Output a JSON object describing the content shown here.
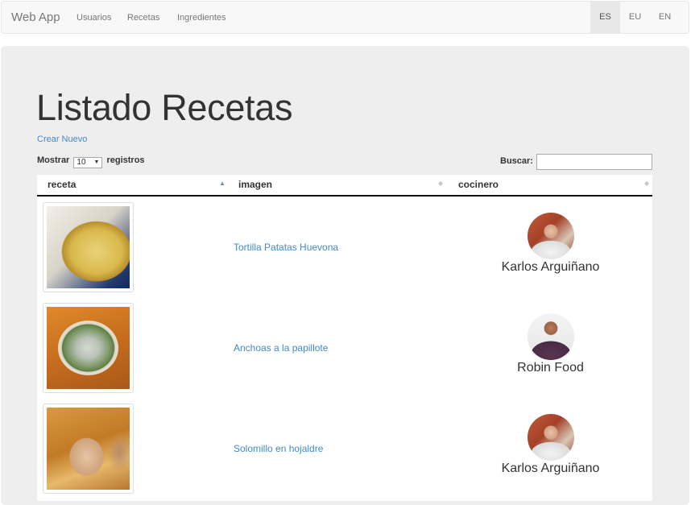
{
  "navbar": {
    "brand": "Web App",
    "links": [
      "Usuarios",
      "Recetas",
      "Ingredientes"
    ],
    "languages": [
      "ES",
      "EU",
      "EN"
    ],
    "active_language": "ES"
  },
  "page": {
    "title": "Listado Recetas",
    "create_link": "Crear Nuevo",
    "show_label": "Mostrar",
    "page_size": "10",
    "records_label": "registros",
    "search_label": "Buscar:",
    "search_value": ""
  },
  "table": {
    "columns": [
      "receta",
      "imagen",
      "cocinero"
    ],
    "rows": [
      {
        "image": "tortilla-photo",
        "recipe": "Tortilla Patatas Huevona",
        "chef": "Karlos Arguiñano"
      },
      {
        "image": "anchoas-photo",
        "recipe": "Anchoas a la papillote",
        "chef": "Robin Food"
      },
      {
        "image": "solomillo-photo",
        "recipe": "Solomillo en hojaldre",
        "chef": "Karlos Arguiñano"
      }
    ]
  }
}
